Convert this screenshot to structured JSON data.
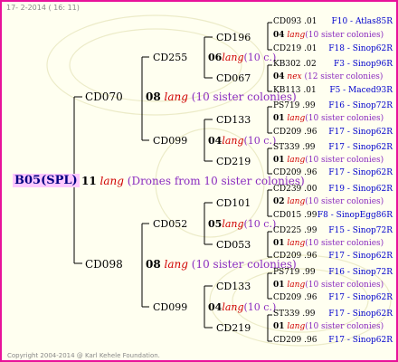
{
  "header": {
    "date": "17-  2-2014 ( 16: 11)"
  },
  "footer": {
    "copyright": "Copyright 2004-2014 @ Karl Kehele Foundation."
  },
  "root": {
    "id": "B05(SPL)",
    "num": "11",
    "lang": "lang",
    "note": "(Drones from 10 sister colonies)"
  },
  "gen1": [
    {
      "id": "CD070",
      "num": "08",
      "lang": "lang",
      "note": "(10 sister colonies)"
    },
    {
      "id": "CD098",
      "num": "08",
      "lang": "lang",
      "note": "(10 sister colonies)"
    }
  ],
  "gen2": [
    {
      "id": "CD255",
      "num": "06",
      "lang": "lang",
      "note": "(10 c.)"
    },
    {
      "id": "CD099",
      "num": "04",
      "lang": "lang",
      "note": "(10 c.)"
    },
    {
      "id": "CD052",
      "num": "05",
      "lang": "lang",
      "note": "(10 c.)"
    },
    {
      "id": "CD099",
      "num": "04",
      "lang": "lang",
      "note": "(10 c.)"
    }
  ],
  "gen3": [
    {
      "id": "CD196",
      "num": "04",
      "lang": "lang",
      "note": "(10 sister colonies)"
    },
    {
      "id": "CD067",
      "num": "04",
      "lang": "nex",
      "note": "(12 sister colonies)"
    },
    {
      "id": "CD133",
      "num": "01",
      "lang": "lang",
      "note": "(10 sister colonies)"
    },
    {
      "id": "CD219",
      "num": "01",
      "lang": "lang",
      "note": "(10 sister colonies)"
    },
    {
      "id": "CD101",
      "num": "02",
      "lang": "lang",
      "note": "(10 sister colonies)"
    },
    {
      "id": "CD053",
      "num": "01",
      "lang": "lang",
      "note": "(10 sister colonies)"
    },
    {
      "id": "CD133",
      "num": "01",
      "lang": "lang",
      "note": "(10 sister colonies)"
    },
    {
      "id": "CD219",
      "num": "01",
      "lang": "lang",
      "note": "(10 sister colonies)"
    }
  ],
  "gen4": [
    {
      "id": "CD093 .01",
      "loc": "F10 - Atlas85R"
    },
    {
      "id": "CD219 .01",
      "loc": "F18 - Sinop62R"
    },
    {
      "id": "KB302 .02",
      "loc": "F3 - Sinop96R"
    },
    {
      "id": "KB113 .01",
      "loc": "F5 - Maced93R"
    },
    {
      "id": "PS719 .99",
      "loc": "F16 - Sinop72R"
    },
    {
      "id": "CD209 .96",
      "loc": "F17 - Sinop62R"
    },
    {
      "id": "ST339 .99",
      "loc": "F17 - Sinop62R"
    },
    {
      "id": "CD209 .96",
      "loc": "F17 - Sinop62R"
    },
    {
      "id": "CD239 .00",
      "loc": "F19 - Sinop62R"
    },
    {
      "id": "CD015 .99",
      "loc": "F8 - SinopEgg86R"
    },
    {
      "id": "CD225 .99",
      "loc": "F15 - Sinop72R"
    },
    {
      "id": "CD209 .96",
      "loc": "F17 - Sinop62R"
    },
    {
      "id": "PS719 .99",
      "loc": "F16 - Sinop72R"
    },
    {
      "id": "CD209 .96",
      "loc": "F17 - Sinop62R"
    },
    {
      "id": "ST339 .99",
      "loc": "F17 - Sinop62R"
    },
    {
      "id": "CD209 .96",
      "loc": "F17 - Sinop62R"
    }
  ],
  "colors": {
    "border": "#e8129a",
    "background": "#fffff0",
    "root_bg": "#ffc8ff",
    "id_blue": "#000080",
    "lang_red": "#d00000",
    "note_purple": "#8a2bbf",
    "loc_blue": "#0000cc"
  }
}
